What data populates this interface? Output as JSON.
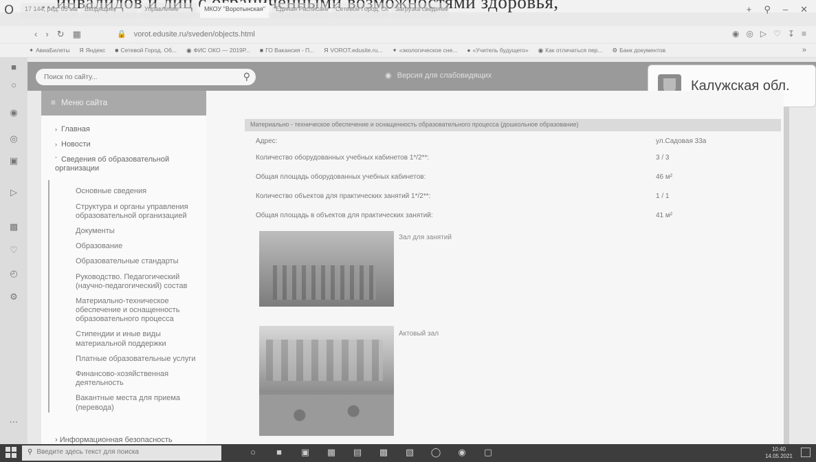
{
  "document_heading": "...инвалидов и лиц с ограниченными возможностями здоровья,",
  "browser": {
    "tabs": [
      {
        "label": "17 144, ред. 05 мая окт"
      },
      {
        "label": "Входящие"
      },
      {
        "label": "Управление"
      },
      {
        "label": "МКОУ \"Воротынская\"",
        "active": true
      },
      {
        "label": "Единая Расписание"
      },
      {
        "label": "Сетевой Город. Образ"
      },
      {
        "label": "Загрузка сведений"
      }
    ],
    "url": "vorot.edusite.ru/sveden/objects.html",
    "bookmarks": [
      "АвиаБилеты",
      "Яндекс",
      "Сетевой Город. Об...",
      "ФИС ОКО — 2019Р...",
      "ГО Вакансия - П...",
      "VOROT.edusite.ru...",
      "«экологическое сне...",
      "«Учитель будущего»",
      "Как отличаться пер...",
      "Банк документов"
    ]
  },
  "site": {
    "search_placeholder": "Поиск по сайту...",
    "accessibility_label": "Версия для слабовидящих",
    "region_name": "Калужская обл.",
    "menu_title": "Меню сайта",
    "menu_top": [
      {
        "label": "Главная"
      },
      {
        "label": "Новости"
      },
      {
        "label": "Сведения об образовательной организации"
      }
    ],
    "submenu": [
      "Основные сведения",
      "Структура и органы управления образовательной организацией",
      "Документы",
      "Образование",
      "Образовательные стандарты",
      "Руководство. Педагогический (научно-педагогический) состав",
      "Материально-техническое обеспечение и оснащенность образовательного процесса",
      "Стипендии и иные виды материальной поддержки",
      "Платные образовательные услуги",
      "Финансово-хозяйственная деятельность",
      "Вакантные места для приема (перевода)"
    ],
    "menu_bottom": "Информационная безопасность"
  },
  "content": {
    "section_title": "Материально - техническое обеспечение и оснащенность образовательного процесса (дошкольное образование)",
    "rows": [
      {
        "label": "Адрес:",
        "value": "ул.Садовая 33а"
      },
      {
        "label": "Количество оборудованных учебных кабинетов 1*/2**:",
        "value": "3 / 3"
      },
      {
        "label": "Общая площадь оборудованных учебных кабинетов:",
        "value": "46 м²"
      },
      {
        "label": "Количество объектов для практических занятий 1*/2**:",
        "value": "1 / 1"
      },
      {
        "label": "Общая площадь в объектов для практических занятий:",
        "value": "41 м²"
      }
    ],
    "photos": [
      {
        "caption": "Зал для занятий"
      },
      {
        "caption": "Актовый зал"
      }
    ]
  },
  "taskbar": {
    "search_placeholder": "Введите здесь текст для поиска",
    "time": "10:40",
    "date": "14.05.2021"
  }
}
